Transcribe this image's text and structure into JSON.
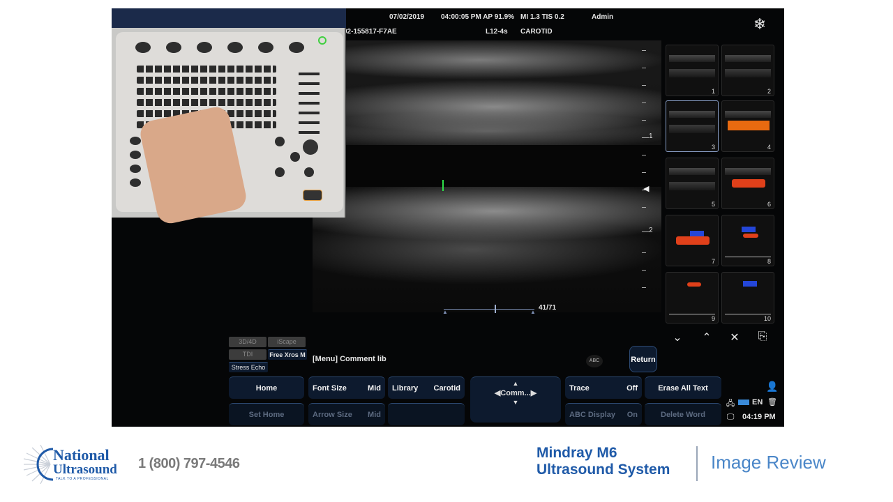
{
  "header": {
    "date": "07/02/2019",
    "time_ap": "04:00:05 PM AP 91.9%",
    "mi_tis": "MI 1.3 TIS 0.2",
    "user": "Admin",
    "patient_id": "02-155817-F7AE",
    "probe": "L12-4s",
    "exam": "CAROTID",
    "freeze_icon": "snowflake-icon"
  },
  "image": {
    "depth_labels": [
      "1",
      "2"
    ],
    "scale_readout": "41/71"
  },
  "thumbnails": [
    "1",
    "2",
    "3",
    "4",
    "5",
    "6",
    "7",
    "8",
    "9",
    "10"
  ],
  "thumb_actions": [
    "double-chevron-down-icon",
    "double-chevron-up-icon",
    "close-icon",
    "export-icon"
  ],
  "modes": {
    "m1": "3D/4D",
    "m2": "iScape",
    "m3": "TDI",
    "m4": "Free Xros M",
    "m5": "Stress Echo"
  },
  "comment": {
    "menu_label": "[Menu] Comment lib",
    "abc": "ABC",
    "return": "Return"
  },
  "controls": {
    "home": "Home",
    "font_size": "Font Size",
    "font_size_val": "Mid",
    "library": "Library",
    "library_val": "Carotid",
    "comm": "Comm...",
    "trace": "Trace",
    "trace_val": "Off",
    "erase_all": "Erase All Text",
    "set_home": "Set Home",
    "arrow_size": "Arrow Size",
    "arrow_size_val": "Mid",
    "abc_display": "ABC Display",
    "abc_display_val": "On",
    "delete_word": "Delete Word"
  },
  "status": {
    "lang": "EN",
    "clock": "04:19 PM"
  },
  "footer": {
    "brand_line1": "National",
    "brand_line2": "Ultrasound",
    "brand_tagline": "TALK TO A PROFESSIONAL",
    "phone": "1 (800) 797-4546",
    "product_line1": "Mindray M6",
    "product_line2": "Ultrasound System",
    "section": "Image Review"
  },
  "colors": {
    "accent_blue": "#1f5aa8",
    "button_navy": "#0d1a2e",
    "flow_red": "#e0401a"
  }
}
